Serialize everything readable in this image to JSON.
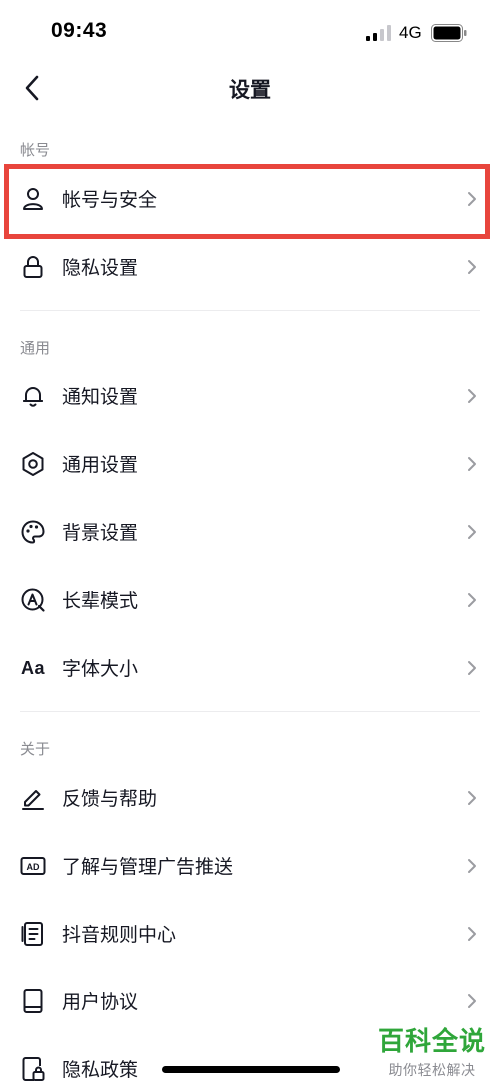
{
  "status_bar": {
    "time": "09:43",
    "network": "4G"
  },
  "nav": {
    "title": "设置"
  },
  "sections": {
    "account": {
      "header": "帐号"
    },
    "general": {
      "header": "通用"
    },
    "about": {
      "header": "关于"
    }
  },
  "rows": {
    "account_security": "帐号与安全",
    "privacy_settings": "隐私设置",
    "notification_settings": "通知设置",
    "general_settings": "通用设置",
    "background_settings": "背景设置",
    "elder_mode": "长辈模式",
    "font_size": "字体大小",
    "font_size_icon_text": "Aa",
    "ad_icon_text": "AD",
    "feedback_help": "反馈与帮助",
    "ad_management": "了解与管理广告推送",
    "rules_center": "抖音规则中心",
    "user_agreement": "用户协议",
    "privacy_policy": "隐私政策"
  },
  "watermark": {
    "title": "百科全说",
    "subtitle": "助你轻松解决"
  },
  "colors": {
    "highlight": "#e8453c",
    "watermark": "#2fa63a",
    "section_header": "#8a8b91",
    "divider": "#ececee"
  }
}
